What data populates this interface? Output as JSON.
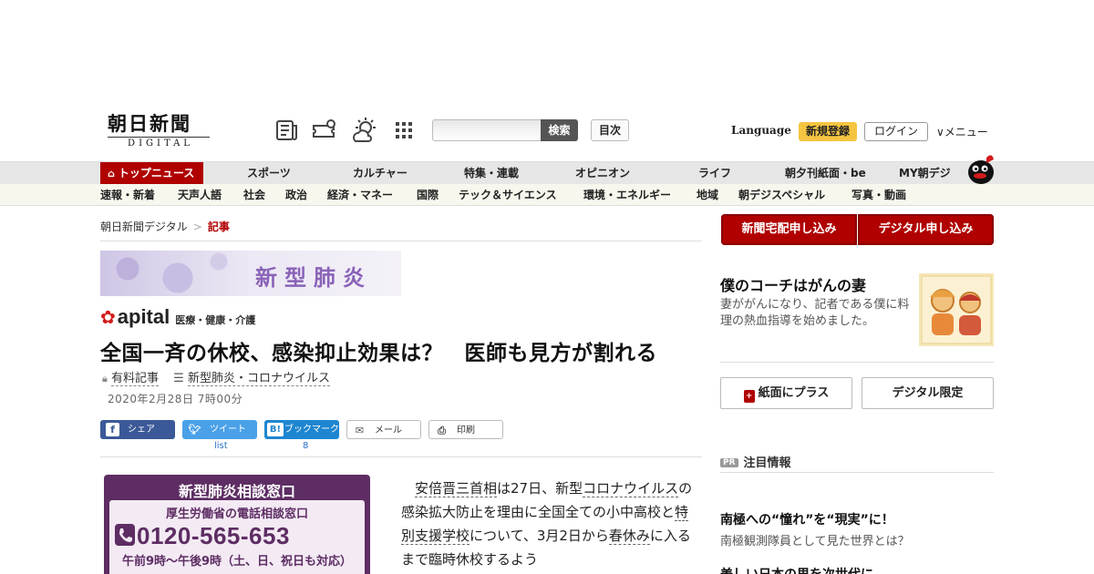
{
  "header": {
    "logo_main": "朝日新聞",
    "logo_sub": "DIGITAL",
    "search_button": "検索",
    "toc_button": "目次",
    "language": "Language",
    "register": "新規登録",
    "login": "ログイン",
    "menu": "∨メニュー"
  },
  "main_nav": [
    "トップニュース",
    "スポーツ",
    "カルチャー",
    "特集・連載",
    "オピニオン",
    "ライフ",
    "朝夕刊紙面・be",
    "MY朝デジ"
  ],
  "sub_nav": [
    "速報・新着",
    "天声人語",
    "社会",
    "政治",
    "経済・マネー",
    "国際",
    "テック＆サイエンス",
    "環境・エネルギー",
    "地域",
    "朝デジスペシャル",
    "写真・動画"
  ],
  "breadcrumb": {
    "home": "朝日新聞デジタル",
    "sep": ">",
    "current": "記事"
  },
  "banner": {
    "text": "新型肺炎"
  },
  "apital": {
    "brand": "apital",
    "tag": "医療・健康・介護"
  },
  "article": {
    "headline": "全国一斉の休校、感染抑止効果は？　医師も見方が割れる",
    "paid_label": "有料記事",
    "topic": "新型肺炎・コロナウイルス",
    "date": "2020年2月28日 7時00分"
  },
  "share": {
    "facebook": "シェア",
    "twitter": "ツイート",
    "twitter_count": "list",
    "hatena": "ブックマーク",
    "hatena_count": "8",
    "mail": "メール",
    "print": "印刷"
  },
  "consult": {
    "title": "新型肺炎相談窓口",
    "org": "厚生労働省の電話相談窓口",
    "phone": "0120-565-653",
    "hours": "午前9時～午後9時（土、日、祝日も対応）"
  },
  "body": {
    "p1a": "安倍晋三首相",
    "p1b": "は27日、新型",
    "p1c": "コロナウイルス",
    "p1d": "の感染拡大防止を理由に全国全ての小中高校と",
    "p1e": "特別支援学校",
    "p1f": "について、3月2日から",
    "p1g": "春休み",
    "p1h": "に入るまで臨時休校するよう"
  },
  "sidebar": {
    "delivery_button": "新聞宅配申し込み",
    "digital_button": "デジタル申し込み",
    "feature_title": "僕のコーチはがんの妻",
    "feature_desc": "妻ががんになり、記者である僕に料理の熱血指導を始めました。",
    "plus_button": "紙面にプラス",
    "limited_button": "デジタル限定",
    "pr_badge": "PR",
    "pr_heading": "注目情報",
    "pr1_title": "南極への“憧れ”を“現実”に！",
    "pr1_desc": "南極観測隊員として見た世界とは？",
    "pr2_title": "美しい日本の里を次世代に"
  },
  "colors": {
    "brand_red": "#b00000",
    "consult_purple": "#5d2d63",
    "register_yellow": "#f5c542"
  },
  "icons": [
    "newspaper-icon",
    "ticket-icon",
    "weather-icon",
    "grid-menu-icon",
    "home-icon",
    "lock-icon",
    "list-icon",
    "mail-icon",
    "print-icon",
    "phone-icon"
  ]
}
